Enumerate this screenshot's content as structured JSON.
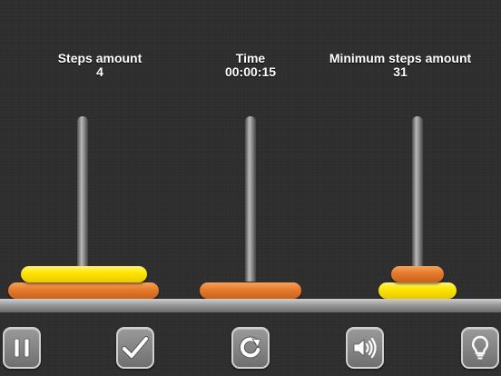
{
  "stats": {
    "steps": {
      "label": "Steps amount",
      "value": "4"
    },
    "time": {
      "label": "Time",
      "value": "00:00:15"
    },
    "minimum": {
      "label": "Minimum steps amount",
      "value": "31"
    }
  },
  "rods": [
    {
      "disks": [
        "orange-large",
        "yellow-large"
      ]
    },
    {
      "disks": [
        "orange-large"
      ]
    },
    {
      "disks": [
        "yellow-small",
        "orange-small"
      ]
    }
  ],
  "toolbar": {
    "buttons": [
      {
        "name": "pause",
        "icon": "pause-icon"
      },
      {
        "name": "check",
        "icon": "checkmark-icon"
      },
      {
        "name": "restart",
        "icon": "restart-icon"
      },
      {
        "name": "sound",
        "icon": "speaker-icon"
      },
      {
        "name": "hint",
        "icon": "lightbulb-icon"
      }
    ]
  },
  "colors": {
    "background": "#2e2e2e",
    "disk_yellow": "#ffe600",
    "disk_orange": "#e57a2a",
    "text": "#ffffff"
  }
}
